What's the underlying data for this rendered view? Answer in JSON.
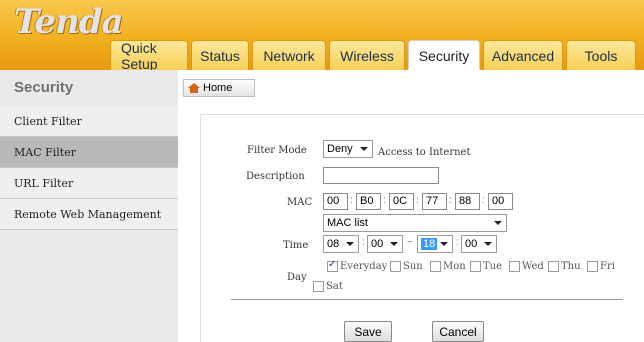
{
  "brand": {
    "logo_text": "Tenda"
  },
  "tabs": [
    {
      "label": "Quick Setup",
      "active": false
    },
    {
      "label": "Status",
      "active": false
    },
    {
      "label": "Network",
      "active": false
    },
    {
      "label": "Wireless",
      "active": false
    },
    {
      "label": "Security",
      "active": true
    },
    {
      "label": "Advanced",
      "active": false
    },
    {
      "label": "Tools",
      "active": false
    }
  ],
  "section": {
    "title": "Security"
  },
  "home_button": {
    "label": "Home",
    "icon": "home-icon"
  },
  "sidebar": {
    "items": [
      {
        "label": "Client Filter",
        "active": false
      },
      {
        "label": "MAC Filter",
        "active": true
      },
      {
        "label": "URL Filter",
        "active": false
      },
      {
        "label": "Remote Web Management",
        "active": false
      }
    ]
  },
  "form": {
    "filter_mode": {
      "label": "Filter Mode",
      "value": "Deny",
      "suffix": "Access to Internet"
    },
    "description": {
      "label": "Description",
      "value": ""
    },
    "mac": {
      "label": "MAC",
      "octets": [
        "00",
        "B0",
        "0C",
        "77",
        "88",
        "00"
      ],
      "separator": ":"
    },
    "mac_list": {
      "value": "MAC list"
    },
    "time": {
      "label": "Time",
      "start_hour": "08",
      "start_min": "00",
      "tilde": "~",
      "end_hour": "18",
      "end_min": "00",
      "colon": ":"
    },
    "day": {
      "label": "Day",
      "options": [
        {
          "label": "Everyday",
          "checked": true
        },
        {
          "label": "Sun",
          "checked": false
        },
        {
          "label": "Mon",
          "checked": false
        },
        {
          "label": "Tue",
          "checked": false
        },
        {
          "label": "Wed",
          "checked": false
        },
        {
          "label": "Thu",
          "checked": false
        },
        {
          "label": "Fri",
          "checked": false
        },
        {
          "label": "Sat",
          "checked": false
        }
      ]
    }
  },
  "buttons": {
    "save": "Save",
    "cancel": "Cancel"
  },
  "colors": {
    "header": "#f2b021",
    "active_side": "#b9b9b9",
    "time_highlight": "#3399ff"
  }
}
